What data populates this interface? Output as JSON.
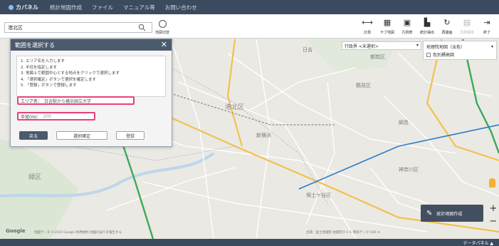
{
  "nav": {
    "brand": "カバネル",
    "items": [
      "統計地図作成",
      "ファイル",
      "マニュアル等",
      "お問い合わせ"
    ]
  },
  "toolbar": {
    "search_value": "港北区",
    "left_tool_label": "地図切替",
    "tools": [
      {
        "label": "計測",
        "icon": "measure-icon",
        "enabled": true
      },
      {
        "label": "サブ地図",
        "icon": "sub-map-icon",
        "enabled": true
      },
      {
        "label": "凡例表",
        "icon": "legend-icon",
        "enabled": true
      },
      {
        "label": "統計抽出",
        "icon": "statistics-icon",
        "enabled": true
      },
      {
        "label": "再描画",
        "icon": "refresh-icon",
        "enabled": true
      },
      {
        "label": "凡例保存",
        "icon": "save-icon",
        "enabled": false
      },
      {
        "label": "終了",
        "icon": "exit-icon",
        "enabled": true
      }
    ]
  },
  "layers": {
    "admin_boundary": "行政界 <未選択>",
    "base_map": "地理院地図（淡色）",
    "shade_label": "色別標高図"
  },
  "dialog": {
    "title": "範囲を選択する",
    "instructions": [
      "1. エリア名を入力します",
      "2. 半径を指定します",
      "3. 地図上で範囲中心とする地点をクリックで選択します",
      "4. 「選択確定」ボタンで選択を確定します",
      "5. 「登録」ボタンで登録します"
    ],
    "area_label": "エリア名：",
    "area_value": "日吉駅から横浜国立大学",
    "radius_label": "半径(m)：",
    "radius_value": "200",
    "back_label": "戻る",
    "confirm_label": "選択確定",
    "register_label": "登録"
  },
  "map": {
    "labels": [
      "港北区",
      "緑区",
      "都筑区",
      "保土ケ谷区",
      "神奈川区",
      "新横浜",
      "日吉",
      "綱島",
      "鶴見区"
    ]
  },
  "controls": {
    "create_label": "統計地図作成",
    "zoom_in": "+",
    "zoom_out": "−"
  },
  "footer": {
    "google": "Google",
    "attribution": "地図データ ©2019 Google 利用規約 地図の誤りを報告する",
    "attribution_right": "出典：国土地理院 地理院タイル 標高データ 500 m",
    "data_panel": "データパネル ▲"
  },
  "colors": {
    "header": "#3b4a5e",
    "dialog_header": "#4b5a6c",
    "highlight": "#e8417a",
    "rail_green": "#3aaa58",
    "rail_blue": "#2a7cc7",
    "highway": "#f2c14e"
  }
}
